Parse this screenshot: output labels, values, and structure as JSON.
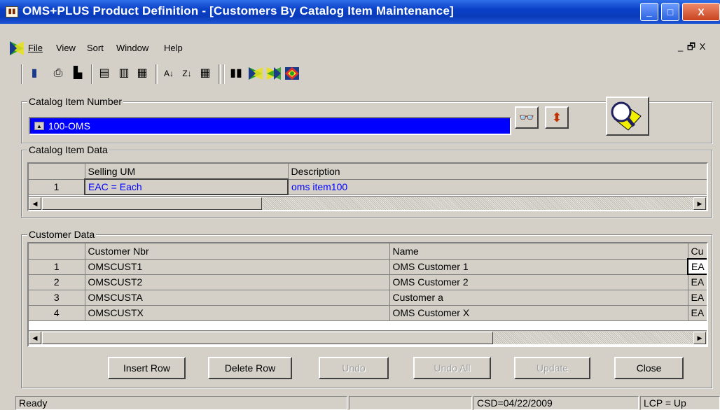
{
  "window": {
    "title": "OMS+PLUS Product Definition - [Customers By Catalog Item Maintenance]",
    "title_icon": "book-icon",
    "controls": {
      "minimize": "_",
      "maximize": "□",
      "close": "X"
    }
  },
  "menu": {
    "items": [
      "File",
      "View",
      "Sort",
      "Window",
      "Help"
    ],
    "mdi_controls": "_ 🗗 X"
  },
  "toolbar": {
    "icons": [
      "exit-door-icon",
      "print-icon",
      "print-setup-icon",
      "insert-row-icon",
      "delete-row-icon",
      "update-icon",
      "sort-ascending-icon",
      "sort-descending-icon",
      "sort-columns-icon",
      "book-icon",
      "flag-icon",
      "flag-icon-2",
      "colorful-diamond-icon"
    ]
  },
  "catalog_item_number": {
    "label": "Catalog Item Number",
    "value": "100-OMS"
  },
  "catalog_item_data": {
    "label": "Catalog Item Data",
    "columns": [
      "Selling UM",
      "Description"
    ],
    "rows": [
      {
        "n": "1",
        "selling_um": "EAC = Each",
        "description": "oms item100"
      }
    ]
  },
  "customer_data": {
    "label": "Customer Data",
    "columns": [
      "Customer Nbr",
      "Name",
      "Cu"
    ],
    "rows": [
      {
        "n": "1",
        "customer_nbr": "OMSCUST1",
        "name": "OMS Customer  1",
        "cu": "EA"
      },
      {
        "n": "2",
        "customer_nbr": "OMSCUST2",
        "name": "OMS Customer  2",
        "cu": "EA"
      },
      {
        "n": "3",
        "customer_nbr": "OMSCUSTA",
        "name": "Customer a",
        "cu": "EA"
      },
      {
        "n": "4",
        "customer_nbr": "OMSCUSTX",
        "name": "OMS Customer X",
        "cu": "EA"
      }
    ]
  },
  "buttons": {
    "insert_row": "Insert Row",
    "delete_row": "Delete Row",
    "undo": "Undo",
    "undo_all": "Undo All",
    "update": "Update",
    "close": "Close"
  },
  "status": {
    "message": "Ready",
    "panel2": "",
    "csd": "CSD=04/22/2009",
    "lcp": "LCP = Up"
  },
  "colors": {
    "title_bar": "#0a3fc7",
    "selected_field": "#0000ff",
    "grid_text_blue": "#0000ff"
  }
}
